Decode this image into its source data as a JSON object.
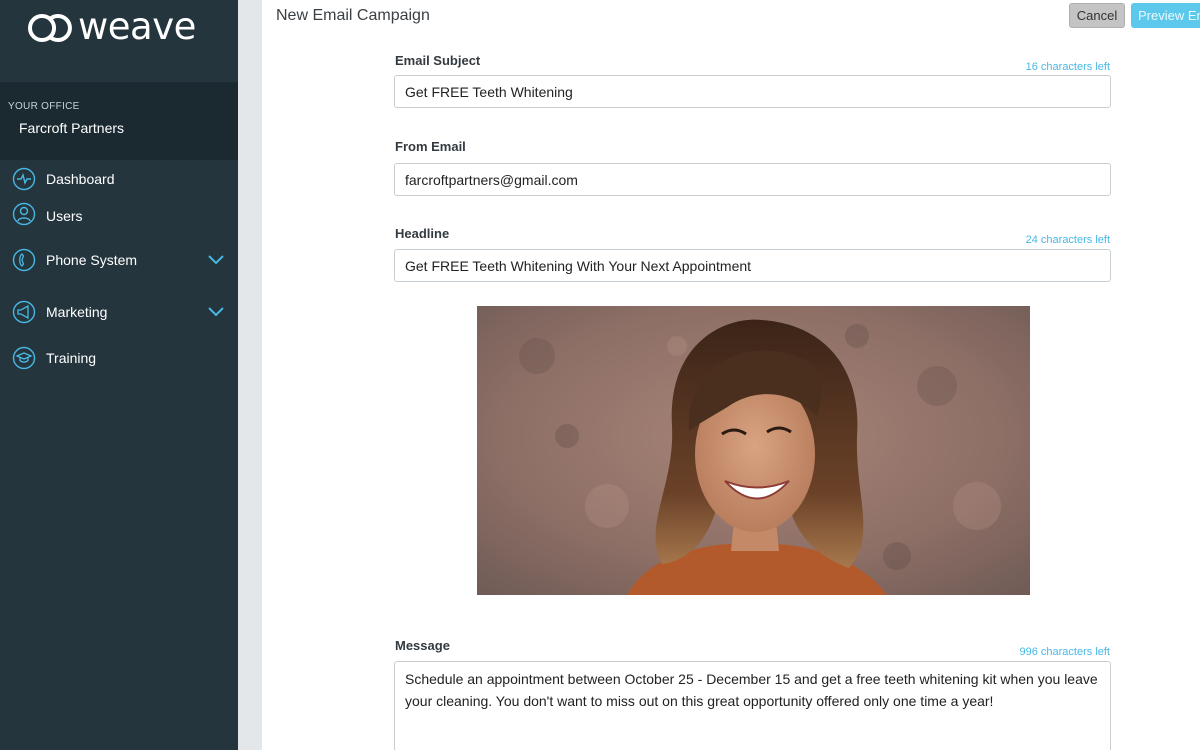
{
  "brand": {
    "name": "weave",
    "accent": "#48b8e4",
    "sidebar_bg": "#24353d"
  },
  "sidebar": {
    "office_label": "YOUR OFFICE",
    "office_name": "Farcroft Partners",
    "items": [
      {
        "label": "Dashboard",
        "icon": "pulse-icon"
      },
      {
        "label": "Users",
        "icon": "user-icon"
      },
      {
        "label": "Phone System",
        "icon": "phone-icon",
        "expandable": true
      },
      {
        "label": "Marketing",
        "icon": "megaphone-icon",
        "expandable": true
      },
      {
        "label": "Training",
        "icon": "graduation-cap-icon"
      }
    ]
  },
  "header": {
    "title": "New Email Campaign",
    "cancel_label": "Cancel",
    "preview_label": "Preview Em"
  },
  "form": {
    "subject": {
      "label": "Email Subject",
      "chars_left": "16 characters left",
      "value": "Get FREE Teeth Whitening"
    },
    "from_email": {
      "label": "From Email",
      "value": "farcroftpartners@gmail.com"
    },
    "headline": {
      "label": "Headline",
      "chars_left": "24 characters left",
      "value": "Get FREE Teeth Whitening With Your Next Appointment"
    },
    "image": {
      "subject": "smiling-woman-photo"
    },
    "message": {
      "label": "Message",
      "chars_left": "996 characters left",
      "value": "Schedule an appointment between October 25 - December 15 and get a free teeth whitening kit when you leave your cleaning. You don't want to miss out on this great opportunity offered only one time a year!"
    }
  }
}
